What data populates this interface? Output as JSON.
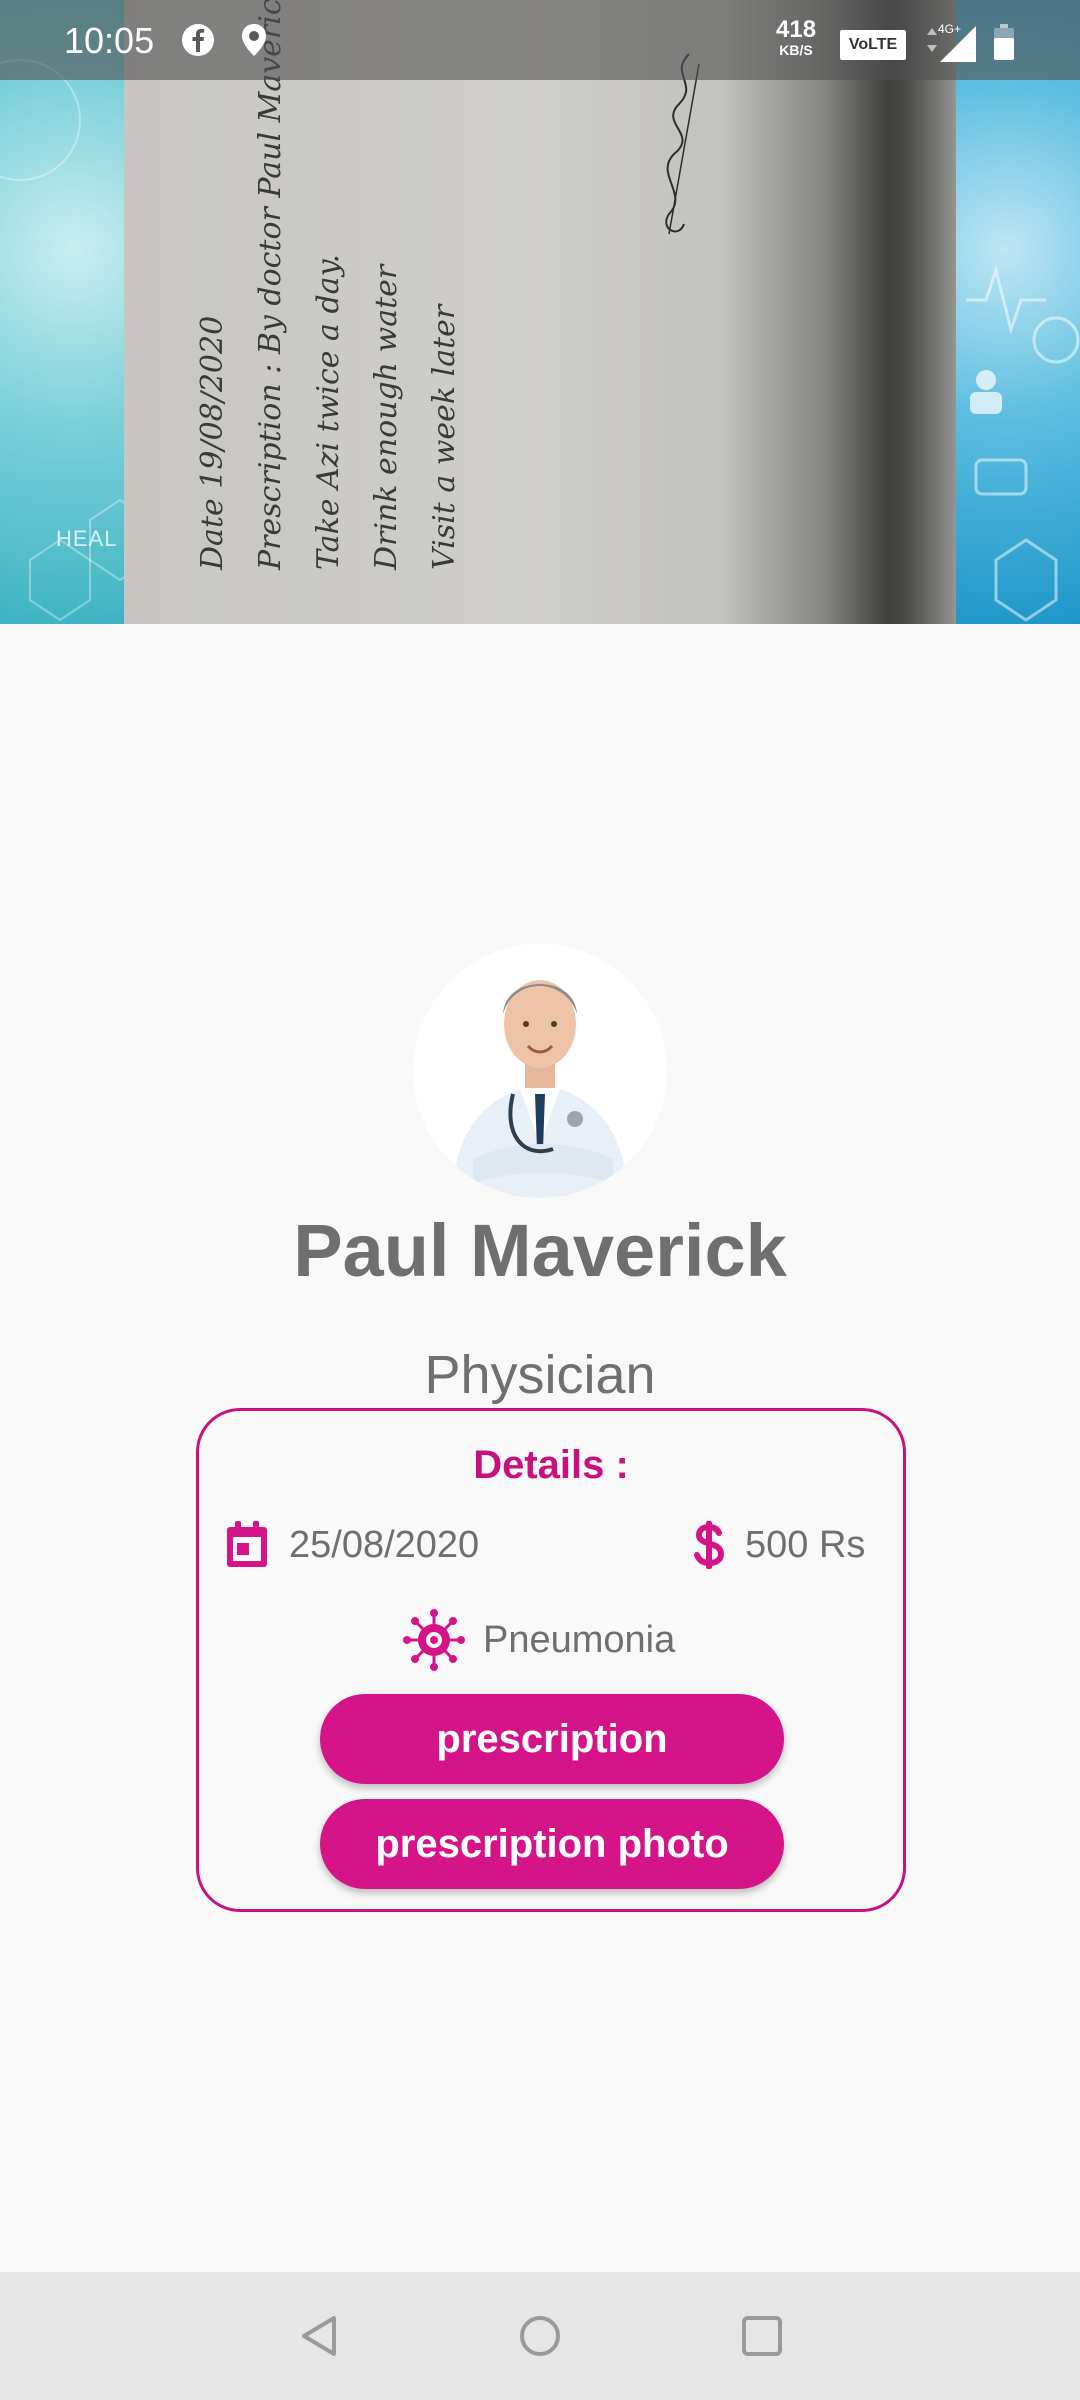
{
  "status_bar": {
    "time": "10:05",
    "net_speed": "418",
    "net_speed_unit": "KB/S",
    "volte": "VoLTE",
    "network_type": "4G+"
  },
  "prescription_image": {
    "left_background_text": "HEAL",
    "lines": [
      "Date 19/08/2020",
      "Prescription : By doctor Paul Maverick",
      "Take Azi twice a day.",
      "Drink enough water",
      "Visit a week later"
    ]
  },
  "doctor": {
    "name": "Paul Maverick",
    "role": "Physician"
  },
  "details": {
    "title": "Details :",
    "date": "25/08/2020",
    "fee": "500 Rs",
    "condition": "Pneumonia",
    "prescription_button": "prescription",
    "prescription_photo_button": "prescription photo"
  },
  "colors": {
    "accent": "#d6148a",
    "text": "#6f6f6f",
    "background": "#f9f9f9"
  },
  "icons": {
    "facebook": "facebook-icon",
    "location": "location-pin-icon",
    "calendar": "calendar-icon",
    "dollar": "dollar-icon",
    "virus": "virus-icon",
    "back": "back-triangle-icon",
    "home": "home-circle-icon",
    "recents": "recents-square-icon"
  }
}
